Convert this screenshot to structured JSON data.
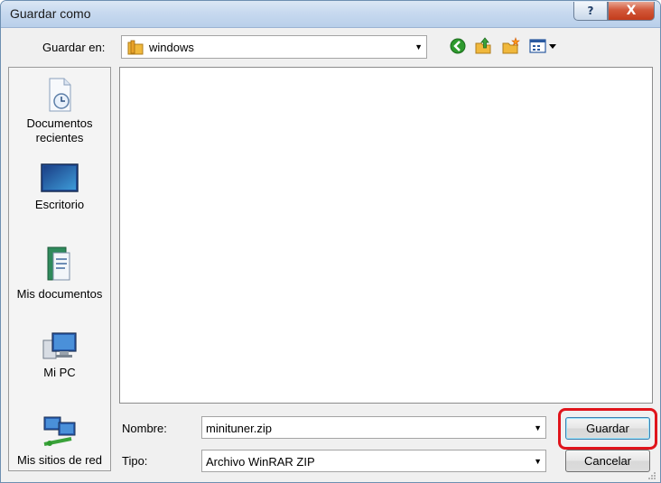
{
  "window": {
    "title": "Guardar como",
    "help_glyph": "?",
    "close_glyph": "X"
  },
  "location": {
    "label": "Guardar en:",
    "value": "windows"
  },
  "toolbar": {
    "icons": [
      "back-icon",
      "up-folder-icon",
      "new-folder-icon",
      "views-menu-icon"
    ]
  },
  "places": [
    {
      "id": "recent",
      "label_line1": "Documentos",
      "label_line2": "recientes"
    },
    {
      "id": "desktop",
      "label_line1": "Escritorio"
    },
    {
      "id": "documents",
      "label_line1": "Mis documentos"
    },
    {
      "id": "computer",
      "label_line1": "Mi PC"
    },
    {
      "id": "network",
      "label_line1": "Mis sitios de red"
    }
  ],
  "form": {
    "filename_label": "Nombre:",
    "filename_value": "minituner.zip",
    "type_label": "Tipo:",
    "type_value": "Archivo WinRAR ZIP"
  },
  "buttons": {
    "save": "Guardar",
    "cancel": "Cancelar"
  },
  "colors": {
    "highlight": "#e0141b",
    "back_arrow": "#2e9a2e",
    "folder": "#f0b83c"
  }
}
